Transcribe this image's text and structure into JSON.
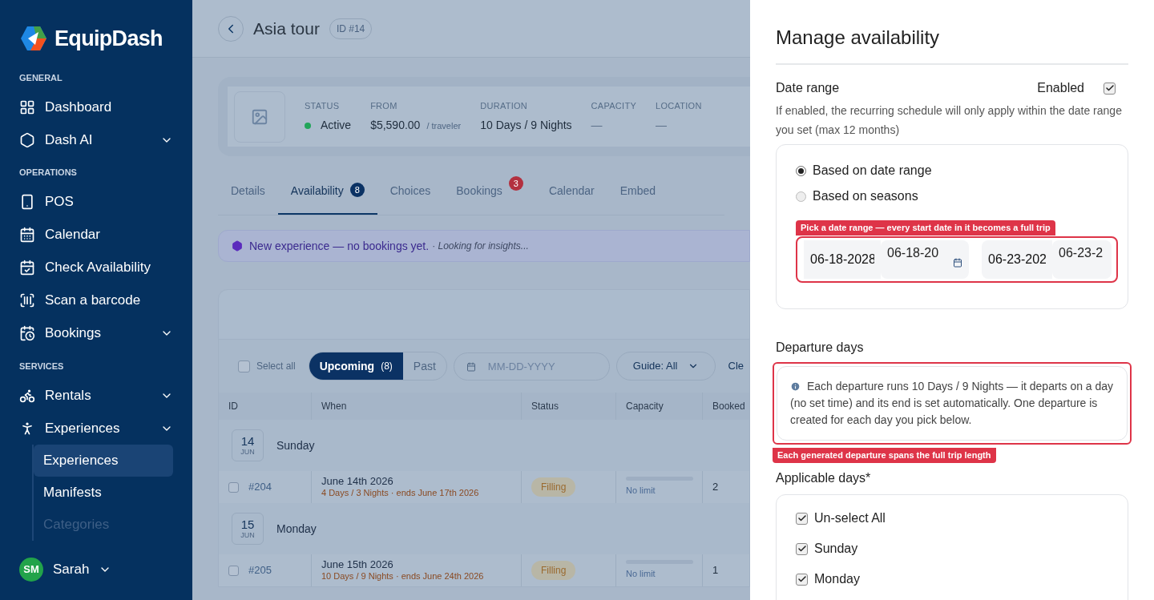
{
  "sidebar": {
    "brand": "EquipDash",
    "sections": [
      {
        "title": "GENERAL",
        "items": [
          {
            "label": "Dashboard",
            "expandable": false,
            "selected": false
          },
          {
            "label": "Dash AI",
            "expandable": true,
            "selected": false
          }
        ]
      },
      {
        "title": "OPERATIONS",
        "items": [
          {
            "label": "POS",
            "expandable": false,
            "selected": false
          },
          {
            "label": "Calendar",
            "expandable": false,
            "selected": false
          },
          {
            "label": "Check Availability",
            "expandable": false,
            "selected": false
          },
          {
            "label": "Scan a barcode",
            "expandable": false,
            "selected": false
          },
          {
            "label": "Bookings",
            "expandable": true,
            "selected": false
          }
        ]
      },
      {
        "title": "SERVICES",
        "items": [
          {
            "label": "Rentals",
            "expandable": true,
            "selected": false
          },
          {
            "label": "Experiences",
            "expandable": true,
            "selected": false,
            "children": [
              {
                "label": "Experiences",
                "selected": true
              },
              {
                "label": "Manifests",
                "selected": false
              },
              {
                "label": "Categories",
                "selected": false
              }
            ]
          }
        ]
      }
    ],
    "user": {
      "initials": "SM",
      "name": "Sarah"
    }
  },
  "header": {
    "title": "Asia tour",
    "id_badge": "ID #14"
  },
  "summary": [
    {
      "label": "STATUS",
      "value": "Active"
    },
    {
      "label": "FROM",
      "value": "$5,590.00",
      "suffix": "/ traveler"
    },
    {
      "label": "DURATION",
      "value": "10 Days / 9 Nights"
    },
    {
      "label": "CAPACITY",
      "value": "—"
    },
    {
      "label": "LOCATION",
      "value": "—"
    }
  ],
  "tabs": [
    {
      "label": "Details",
      "selected": false
    },
    {
      "label": "Availability",
      "selected": true,
      "badge": "8",
      "kind": "count"
    },
    {
      "label": "Choices",
      "selected": false
    },
    {
      "label": "Bookings",
      "selected": false,
      "badge": "3",
      "kind": "alert"
    },
    {
      "label": "Calendar",
      "selected": false
    },
    {
      "label": "Embed",
      "selected": false
    }
  ],
  "banner": {
    "text": "New experience — no bookings yet.",
    "note": "· *Looking for insights...*"
  },
  "toolbar": {
    "select_all": "Select all",
    "select_all_checked": false,
    "segments": [
      {
        "label": "Upcoming",
        "count": "(8)",
        "selected": true
      },
      {
        "label": "Past",
        "selected": false
      }
    ],
    "date_placeholder": "MM-DD-YYYY",
    "guide_filter": "Guide: All",
    "clear": "Cle"
  },
  "table": {
    "columns": [
      "ID",
      "When",
      "Status",
      "Capacity",
      "Booked"
    ],
    "groups": [
      {
        "day": "14",
        "month": "JUN",
        "weekday": "Sunday",
        "rows": [
          {
            "id": "#204",
            "checked": false,
            "date": "June 14th 2026",
            "detail": "4 Days / 3 Nights · ends June 17th 2026",
            "status": "Filling",
            "capacity": "No limit",
            "booked": "2"
          }
        ]
      },
      {
        "day": "15",
        "month": "JUN",
        "weekday": "Monday",
        "rows": [
          {
            "id": "#205",
            "checked": false,
            "date": "June 15th 2026",
            "detail": "10 Days / 9 Nights · ends June 24th 2026",
            "status": "Filling",
            "capacity": "No limit",
            "booked": "1"
          }
        ]
      }
    ]
  },
  "drawer": {
    "title": "Manage availability",
    "date_range": {
      "label": "Date range",
      "enabled_label": "Enabled",
      "enabled": true,
      "help": "If enabled, the recurring schedule will only apply within the date range you set (max 12 months)",
      "options": [
        {
          "label": "Based on date range",
          "selected": true
        },
        {
          "label": "Based on seasons",
          "selected": false
        }
      ],
      "callout": "Pick a date range — every start date in it becomes a full trip",
      "start": [
        "06-18-2028",
        "06-18-20"
      ],
      "end": [
        "06-23-202",
        "06-23-2"
      ]
    },
    "departure": {
      "label": "Departure days",
      "info": "Each departure runs 10 Days / 9 Nights — it departs on a day (no set time) and its end is set automatically. One departure is created for each day you pick below.",
      "callout": "Each generated departure spans the full trip length"
    },
    "applicable": {
      "label": "Applicable days*",
      "days": [
        {
          "label": "Un-select All",
          "checked": true
        },
        {
          "label": "Sunday",
          "checked": true
        },
        {
          "label": "Monday",
          "checked": true
        }
      ]
    }
  }
}
